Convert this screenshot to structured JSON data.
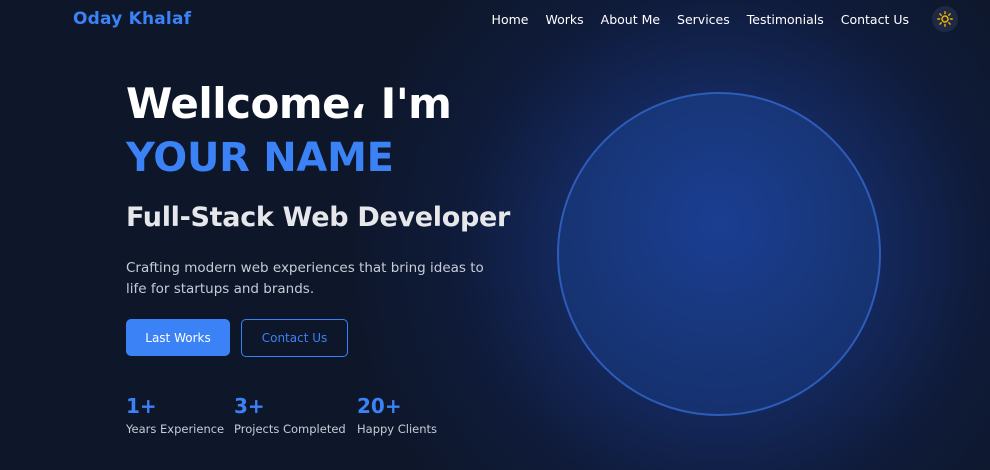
{
  "header": {
    "brand": "Oday Khalaf",
    "nav": [
      "Home",
      "Works",
      "About Me",
      "Services",
      "Testimonials",
      "Contact Us"
    ],
    "theme_toggle_icon": "sun-icon"
  },
  "hero": {
    "heading": "Wellcome، I'm",
    "name": "YOUR NAME",
    "role": "Full-Stack Web Developer",
    "description": "Crafting modern web experiences that bring ideas to life for startups and brands.",
    "primary_button": "Last Works",
    "secondary_button": "Contact Us"
  },
  "stats": [
    {
      "value": "1+",
      "label": "Years Experience"
    },
    {
      "value": "3+",
      "label": "Projects Completed"
    },
    {
      "value": "20+",
      "label": "Happy Clients"
    }
  ],
  "colors": {
    "accent": "#3b82f6",
    "background": "#0e1629",
    "sun": "#f5b301"
  }
}
